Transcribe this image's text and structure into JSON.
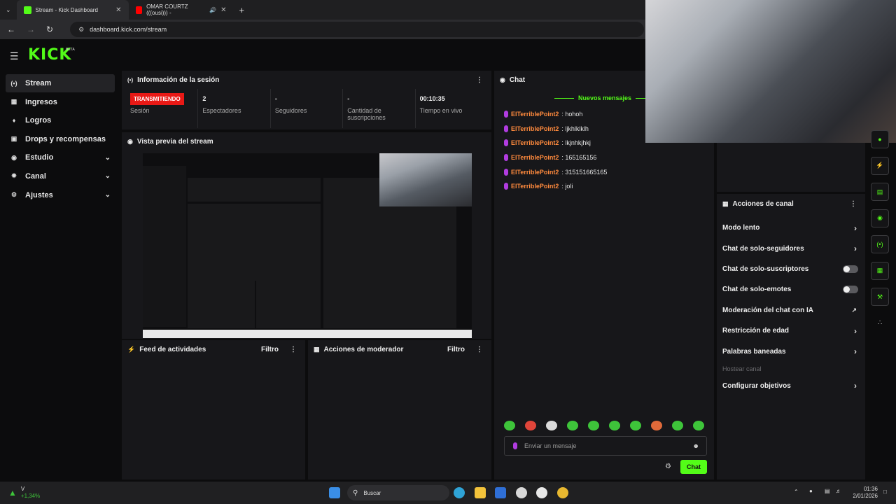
{
  "browser": {
    "tabs": [
      {
        "title": "Stream - Kick Dashboard"
      },
      {
        "title": "OMAR COURTZ (((ousi))) - "
      }
    ],
    "new_tab": "+",
    "url": "dashboard.kick.com/stream"
  },
  "app": {
    "logo": "KICK",
    "logo_badge": "BETA",
    "nav": [
      {
        "label": "Stream",
        "icon": "broadcast-icon"
      },
      {
        "label": "Ingresos",
        "icon": "chart-icon"
      },
      {
        "label": "Logros",
        "icon": "trophy-icon"
      },
      {
        "label": "Drops y recompensas",
        "icon": "gift-icon"
      },
      {
        "label": "Estudio",
        "icon": "palette-icon"
      },
      {
        "label": "Canal",
        "icon": "gear-icon"
      },
      {
        "label": "Ajustes",
        "icon": "gear-icon"
      }
    ]
  },
  "session": {
    "title": "Información de la sesión",
    "status_badge": "TRANSMITIENDO",
    "stats": [
      {
        "label": "Sesión"
      },
      {
        "value": "2",
        "label": "Espectadores"
      },
      {
        "value": "-",
        "label": "Seguidores"
      },
      {
        "value": "-",
        "label": "Cantidad de suscripciones"
      },
      {
        "value": "00:10:35",
        "label": "Tiempo en vivo"
      }
    ]
  },
  "preview": {
    "title": "Vista previa del stream"
  },
  "activity": {
    "title": "Feed de actividades",
    "filter": "Filtro"
  },
  "mod_actions": {
    "title": "Acciones de moderador",
    "filter": "Filtro"
  },
  "chat": {
    "title": "Chat",
    "new_messages": "Nuevos mensajes",
    "messages": [
      {
        "user": "ElTerriblePoint2",
        "text": ": hohoh"
      },
      {
        "user": "ElTerriblePoint2",
        "text": ": ljkhlklklh"
      },
      {
        "user": "ElTerriblePoint2",
        "text": ": lkjnhkjhkj"
      },
      {
        "user": "ElTerriblePoint2",
        "text": ": 165165156"
      },
      {
        "user": "ElTerriblePoint2",
        "text": ": 315151665165"
      },
      {
        "user": "ElTerriblePoint2",
        "text": ": joli"
      }
    ],
    "placeholder": "Enviar un mensaje",
    "send_label": "Chat"
  },
  "channel_actions": {
    "title": "Acciones de canal",
    "items": [
      {
        "label": "Modo lento"
      },
      {
        "label": "Chat de solo-seguidores"
      },
      {
        "label": "Chat de solo-suscriptores"
      },
      {
        "label": "Chat de solo-emotes"
      },
      {
        "label": "Moderación del chat con IA"
      },
      {
        "label": "Restricción de edad"
      },
      {
        "label": "Palabras baneadas"
      },
      {
        "label": "Hostear canal"
      },
      {
        "label": "Configurar objetivos"
      }
    ]
  },
  "taskbar": {
    "stock_name": "V",
    "stock_change": "+1,34%",
    "search": "Buscar",
    "time": "01:36",
    "date": "2/01/2026"
  },
  "colors": {
    "accent": "#53fc18",
    "live": "#e91916",
    "username": "#ff8a3d",
    "panel": "#17171a"
  }
}
